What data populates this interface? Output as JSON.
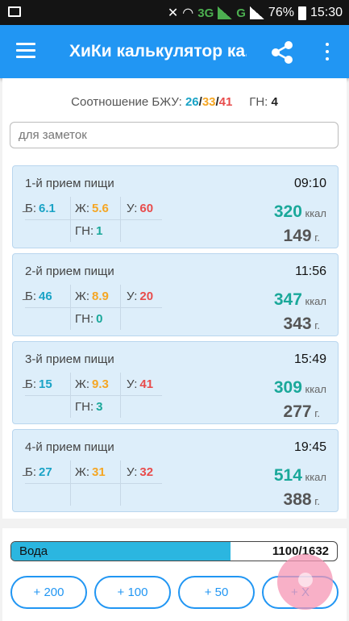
{
  "status_bar": {
    "network": "3G",
    "network2": "G",
    "battery": "76%",
    "time": "15:30"
  },
  "app_bar": {
    "title": "ХиКи калькулятор ка..."
  },
  "ratio": {
    "label": "Соотношение БЖУ:",
    "protein": "26",
    "fat": "33",
    "carbs": "41",
    "sep": "/",
    "gn_label": "ГН:",
    "gn_value": "4"
  },
  "notes": {
    "placeholder": "для заметок"
  },
  "meals": [
    {
      "title": "1-й прием пищи",
      "time": "09:10",
      "b_label": "Б:",
      "b": "6.1",
      "zh_label": "Ж:",
      "zh": "5.6",
      "u_label": "У:",
      "u": "60",
      "gn_label": "ГН:",
      "gn": "1",
      "kcal": "320",
      "kcal_unit": "ккал",
      "grams": "149",
      "grams_unit": "г."
    },
    {
      "title": "2-й прием пищи",
      "time": "11:56",
      "b_label": "Б:",
      "b": "46",
      "zh_label": "Ж:",
      "zh": "8.9",
      "u_label": "У:",
      "u": "20",
      "gn_label": "ГН:",
      "gn": "0",
      "kcal": "347",
      "kcal_unit": "ккал",
      "grams": "343",
      "grams_unit": "г."
    },
    {
      "title": "3-й прием пищи",
      "time": "15:49",
      "b_label": "Б:",
      "b": "15",
      "zh_label": "Ж:",
      "zh": "9.3",
      "u_label": "У:",
      "u": "41",
      "gn_label": "ГН:",
      "gn": "3",
      "kcal": "309",
      "kcal_unit": "ккал",
      "grams": "277",
      "grams_unit": "г."
    },
    {
      "title": "4-й прием пищи",
      "time": "19:45",
      "b_label": "Б:",
      "b": "27",
      "zh_label": "Ж:",
      "zh": "31",
      "u_label": "У:",
      "u": "32",
      "gn_label": "ГН:",
      "gn": "",
      "kcal": "514",
      "kcal_unit": "ккал",
      "grams": "388",
      "grams_unit": "г."
    }
  ],
  "water": {
    "label": "Вода",
    "value": "1100/1632",
    "progress": 0.674
  },
  "water_buttons": [
    "+ 200",
    "+ 100",
    "+ 50",
    "+ X"
  ],
  "icons": {
    "menu": "hamburger-icon",
    "share": "share-icon",
    "more": "more-vert-icon",
    "fab": "add-icon"
  },
  "colors": {
    "app_bar": "#2196f3",
    "protein": "#1aa3c6",
    "fat": "#f5a623",
    "carbs": "#e84c4c",
    "kcal": "#1aa89a",
    "water": "#2bb6e0",
    "meal_card": "#ddeefa"
  }
}
